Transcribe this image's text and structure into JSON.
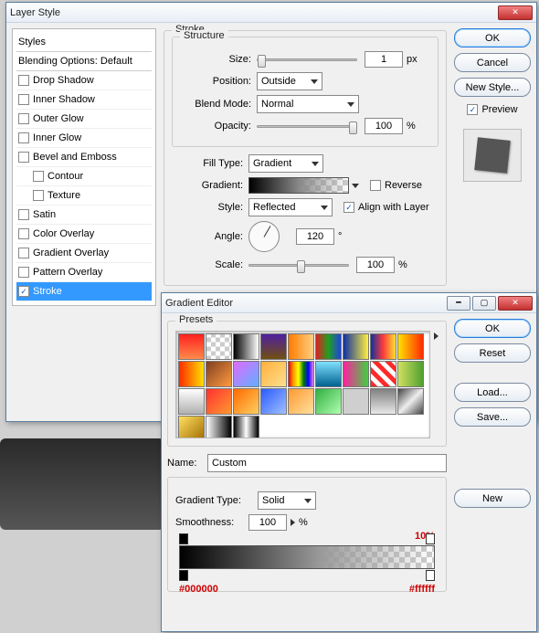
{
  "layerStyle": {
    "title": "Layer Style",
    "stylesHeader": "Styles",
    "blendingHeader": "Blending Options: Default",
    "items": [
      {
        "label": "Drop Shadow",
        "checked": false,
        "selected": false,
        "indent": false
      },
      {
        "label": "Inner Shadow",
        "checked": false,
        "selected": false,
        "indent": false
      },
      {
        "label": "Outer Glow",
        "checked": false,
        "selected": false,
        "indent": false
      },
      {
        "label": "Inner Glow",
        "checked": false,
        "selected": false,
        "indent": false
      },
      {
        "label": "Bevel and Emboss",
        "checked": false,
        "selected": false,
        "indent": false
      },
      {
        "label": "Contour",
        "checked": false,
        "selected": false,
        "indent": true
      },
      {
        "label": "Texture",
        "checked": false,
        "selected": false,
        "indent": true
      },
      {
        "label": "Satin",
        "checked": false,
        "selected": false,
        "indent": false
      },
      {
        "label": "Color Overlay",
        "checked": false,
        "selected": false,
        "indent": false
      },
      {
        "label": "Gradient Overlay",
        "checked": false,
        "selected": false,
        "indent": false
      },
      {
        "label": "Pattern Overlay",
        "checked": false,
        "selected": false,
        "indent": false
      },
      {
        "label": "Stroke",
        "checked": true,
        "selected": true,
        "indent": false
      }
    ],
    "stroke": {
      "legend": "Stroke",
      "structureLegend": "Structure",
      "sizeLabel": "Size:",
      "sizeValue": "1",
      "sizeUnit": "px",
      "positionLabel": "Position:",
      "positionValue": "Outside",
      "blendModeLabel": "Blend Mode:",
      "blendModeValue": "Normal",
      "opacityLabel": "Opacity:",
      "opacityValue": "100",
      "opacityUnit": "%",
      "fillTypeLabel": "Fill Type:",
      "fillTypeValue": "Gradient",
      "gradientLabel": "Gradient:",
      "reverseLabel": "Reverse",
      "reverseChecked": false,
      "styleLabel": "Style:",
      "styleValue": "Reflected",
      "alignLabel": "Align with Layer",
      "alignChecked": true,
      "angleLabel": "Angle:",
      "angleValue": "120",
      "angleUnit": "°",
      "scaleLabel": "Scale:",
      "scaleValue": "100",
      "scaleUnit": "%"
    },
    "buttons": {
      "ok": "OK",
      "cancel": "Cancel",
      "newStyle": "New Style...",
      "previewLabel": "Preview",
      "previewChecked": true
    }
  },
  "gradientEditor": {
    "title": "Gradient Editor",
    "presetsLegend": "Presets",
    "swatches": [
      "linear-gradient(#ff2020,#ff8a4a)",
      "repeating-conic-gradient(#ccc 0 25%, #fff 0 50%) 0/10px 10px",
      "linear-gradient(90deg,#000,#fff)",
      "linear-gradient(#5020a0,#705010)",
      "linear-gradient(90deg,#ff7a00,#ffd080)",
      "linear-gradient(90deg,#e02020,#20a020,#2040e0)",
      "linear-gradient(90deg,#1030a0,#ffef40)",
      "linear-gradient(90deg,#1030a0,#ff3a3a,#ffe030)",
      "linear-gradient(90deg,#ffe000,#ff2a00)",
      "linear-gradient(90deg,#ff2a00,#ffe000)",
      "linear-gradient(135deg,#804020,#ff9a40)",
      "linear-gradient(135deg,#e06aff,#60b0ff)",
      "linear-gradient(135deg,#ffaf3a,#ffe090)",
      "linear-gradient(90deg,red,orange,yellow,green,blue,violet)",
      "linear-gradient(#80e0ff,#006090)",
      "linear-gradient(90deg,#ff20a0,#40d040)",
      "repeating-linear-gradient(45deg,#ff2a2a 0 5px,#fff 5px 10px)",
      "linear-gradient(90deg,#d0e060,#50a030)",
      "linear-gradient(#fff,#b0b0b0)",
      "linear-gradient(135deg,#ff3030,#ff9a30)",
      "linear-gradient(135deg,#ff6a00,#ffd060)",
      "linear-gradient(135deg,#2a5aff,#a0c0ff)",
      "linear-gradient(135deg,#ff9a30,#ffe0a0)",
      "linear-gradient(135deg,#30b040,#b0ffb0)",
      "linear-gradient(90deg,#cfcfcf,#cfcfcf)",
      "linear-gradient(#808080,#e8e8e8)",
      "linear-gradient(135deg,#444,#eee,#444)",
      "linear-gradient(135deg,#ffe060,#a06a00)",
      "linear-gradient(90deg,#fff,#000)",
      "linear-gradient(90deg,#000,#fff,#000)"
    ],
    "nameLabel": "Name:",
    "nameValue": "Custom",
    "typeLabel": "Gradient Type:",
    "typeValue": "Solid",
    "smoothLabel": "Smoothness:",
    "smoothValue": "100",
    "smoothUnit": "%",
    "buttons": {
      "ok": "OK",
      "reset": "Reset",
      "load": "Load...",
      "save": "Save...",
      "new": "New"
    },
    "stops": {
      "leftColor": "#000000",
      "rightColor": "#ffffff",
      "rightOpacity": "10%"
    }
  }
}
